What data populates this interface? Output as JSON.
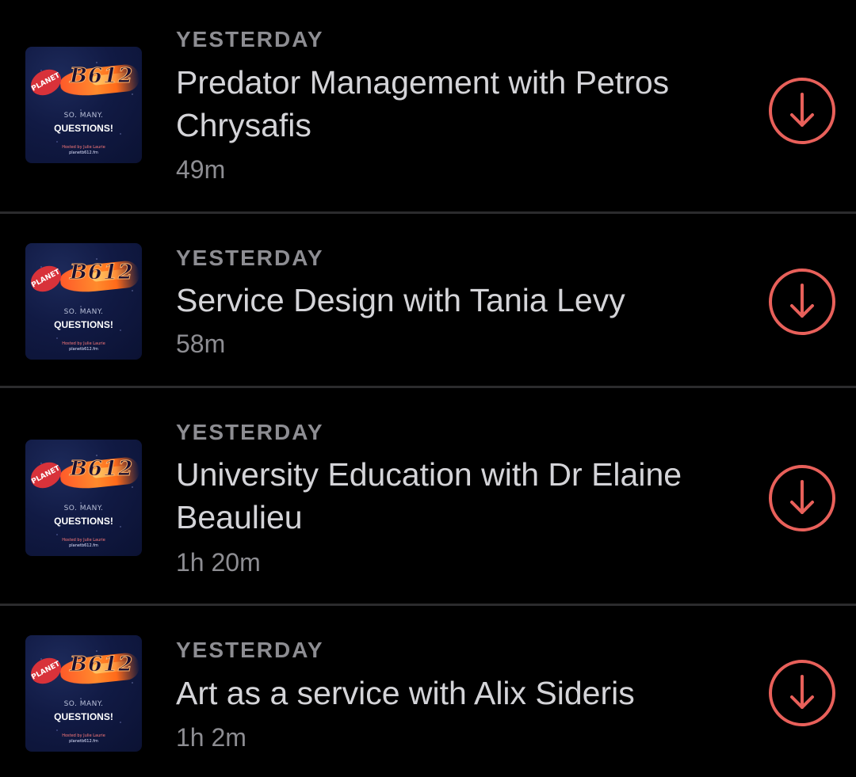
{
  "episodes": [
    {
      "date": "YESTERDAY",
      "title": "Predator Management with Petros Chrysafis",
      "duration": "49m",
      "art": {
        "badge": "PLANET",
        "logo": "B612",
        "line1": "SO. MANY.",
        "line2": "QUESTIONS!",
        "line3": "Hosted by Julie Laurie",
        "line4": "planetb612.fm"
      }
    },
    {
      "date": "YESTERDAY",
      "title": "Service Design with Tania Levy",
      "duration": "58m",
      "art": {
        "badge": "PLANET",
        "logo": "B612",
        "line1": "SO. MANY.",
        "line2": "QUESTIONS!",
        "line3": "Hosted by Julie Laurie",
        "line4": "planetb612.fm"
      }
    },
    {
      "date": "YESTERDAY",
      "title": "University Education with Dr Elaine Beaulieu",
      "duration": "1h 20m",
      "art": {
        "badge": "PLANET",
        "logo": "B612",
        "line1": "SO. MANY.",
        "line2": "QUESTIONS!",
        "line3": "Hosted by Julie Laurie",
        "line4": "planetb612.fm"
      }
    },
    {
      "date": "YESTERDAY",
      "title": "Art as a service with Alix Sideris",
      "duration": "1h 2m",
      "art": {
        "badge": "PLANET",
        "logo": "B612",
        "line1": "SO. MANY.",
        "line2": "QUESTIONS!",
        "line3": "Hosted by Julie Laurie",
        "line4": "planetb612.fm"
      }
    }
  ],
  "icons": {
    "download": "download-icon"
  },
  "colors": {
    "background": "#000000",
    "divider": "#2b2b2d",
    "title": "#d4d4d8",
    "meta": "#8d8d92",
    "accent": "#e8605a"
  }
}
